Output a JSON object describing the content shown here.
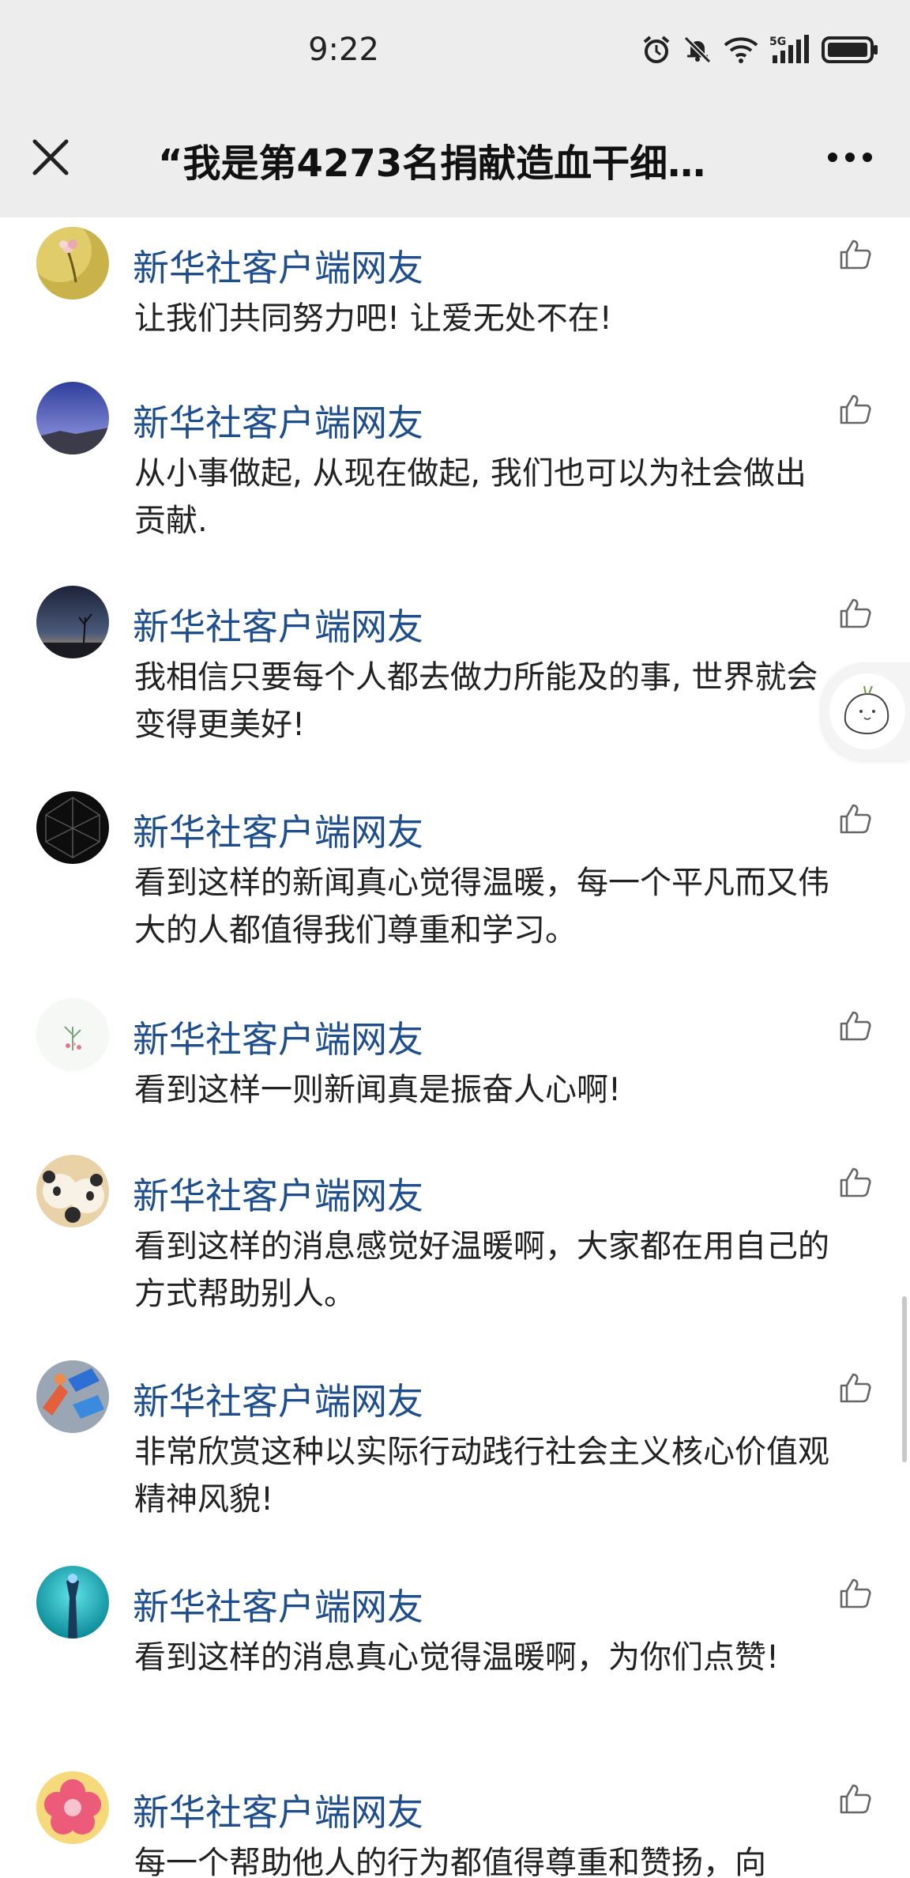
{
  "status_bar": {
    "time": "9:22",
    "icons": [
      "alarm-icon",
      "mute-icon",
      "wifi-icon",
      "5g-signal-icon",
      "battery-icon"
    ],
    "network_label": "5G"
  },
  "nav": {
    "title": "“我是第4273名捐献造血干细…",
    "close_icon": "close-icon",
    "more_icon": "more-icon"
  },
  "comments": [
    {
      "username": "新华社客户端网友",
      "text": "让我们共同努力吧! 让爱无处不在!",
      "avatar": "flower-avatar"
    },
    {
      "username": "新华社客户端网友",
      "text": "从小事做起, 从现在做起, 我们也可以为社会做出贡献.",
      "avatar": "sky-avatar"
    },
    {
      "username": "新华社客户端网友",
      "text": "我相信只要每个人都去做力所能及的事, 世界就会变得更美好!",
      "avatar": "dusk-avatar"
    },
    {
      "username": "新华社客户端网友",
      "text": "看到这样的新闻真心觉得温暖，每一个平凡而又伟大的人都值得我们尊重和学习。",
      "avatar": "geo-avatar"
    },
    {
      "username": "新华社客户端网友",
      "text": "看到这样一则新闻真是振奋人心啊!",
      "avatar": "plant-avatar"
    },
    {
      "username": "新华社客户端网友",
      "text": "看到这样的消息感觉好温暖啊，大家都在用自己的方式帮助别人。",
      "avatar": "panda-avatar"
    },
    {
      "username": "新华社客户端网友",
      "text": "非常欣赏这种以实际行动践行社会主义核心价值观精神风貌!",
      "avatar": "paint-avatar"
    },
    {
      "username": "新华社客户端网友",
      "text": "看到这样的消息真心觉得温暖啊，为你们点赞!",
      "avatar": "statue-avatar"
    },
    {
      "username": "新华社客户端网友",
      "text": "每一个帮助他人的行为都值得尊重和赞扬，向",
      "avatar": "pink-flower-avatar"
    }
  ],
  "colors": {
    "username": "#1f4e8c",
    "header_bg": "#ededed",
    "text": "#222222"
  }
}
